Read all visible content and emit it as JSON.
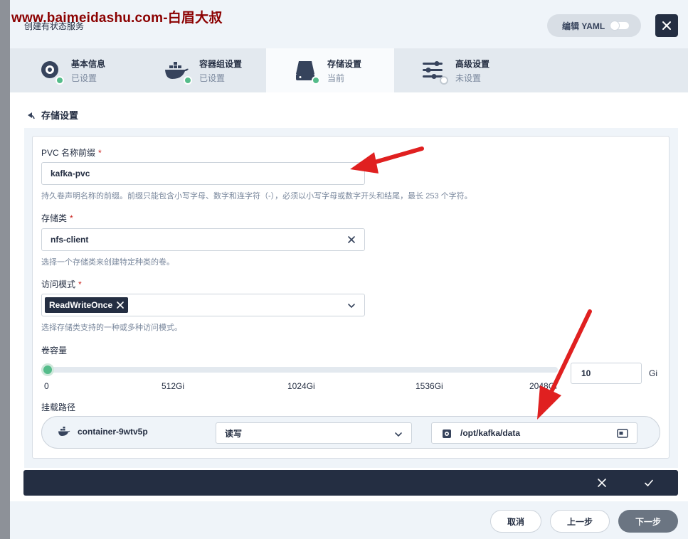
{
  "watermark": "www.baimeidashu.com-白眉大叔",
  "modal": {
    "title": "创建有状态服务",
    "yaml_label": "编辑 YAML"
  },
  "steps": [
    {
      "title": "基本信息",
      "status": "已设置",
      "icon": "disk-icon",
      "state": "done"
    },
    {
      "title": "容器组设置",
      "status": "已设置",
      "icon": "docker-icon",
      "state": "done"
    },
    {
      "title": "存储设置",
      "status": "当前",
      "icon": "storage-icon",
      "state": "current"
    },
    {
      "title": "高级设置",
      "status": "未设置",
      "icon": "sliders-icon",
      "state": "todo"
    }
  ],
  "section": {
    "title": "存储设置"
  },
  "form": {
    "pvc_label": "PVC 名称前缀",
    "pvc_value": "kafka-pvc",
    "pvc_hint": "持久卷声明名称的前缀。前缀只能包含小写字母、数字和连字符（-），必须以小写字母或数字开头和结尾，最长 253 个字符。",
    "storage_class_label": "存储类",
    "storage_class_value": "nfs-client",
    "storage_class_hint": "选择一个存储类来创建特定种类的卷。",
    "access_mode_label": "访问模式",
    "access_mode_tag": "ReadWriteOnce",
    "access_mode_hint": "选择存储类支持的一种或多种访问模式。",
    "capacity_label": "卷容量",
    "capacity_value": "10",
    "capacity_unit": "Gi",
    "capacity_fraction": 0.0049,
    "ticks": [
      "0",
      "512Gi",
      "1024Gi",
      "1536Gi",
      "2048Gi"
    ],
    "mount_label": "挂载路径",
    "mount_container": "container-9wtv5p",
    "mount_mode": "读写",
    "mount_path": "/opt/kafka/data"
  },
  "footer": {
    "cancel": "取消",
    "prev": "上一步",
    "next": "下一步"
  },
  "colors": {
    "accent_green": "#55bc8a",
    "dark": "#242e42",
    "annotation_red": "#e02020"
  }
}
